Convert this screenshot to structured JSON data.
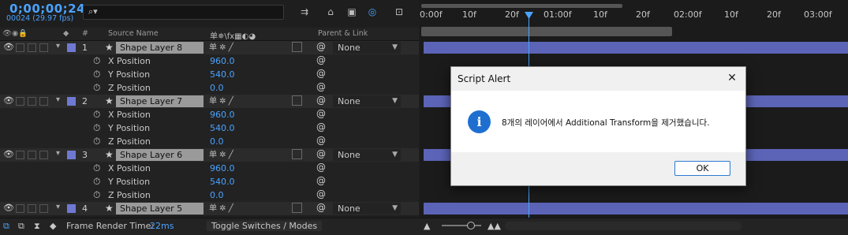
{
  "header": {
    "timecode": "0;00;00;24",
    "frame_info": "00024 (29.97 fps)",
    "search_placeholder": ""
  },
  "columns": {
    "num": "#",
    "source_name": "Source Name",
    "switches": "单✵\\fx▦◐◕",
    "parent_link": "Parent & Link"
  },
  "ruler": {
    "ticks": [
      "0:00f",
      "10f",
      "20f",
      "01:00f",
      "10f",
      "20f",
      "02:00f",
      "10f",
      "20f",
      "03:00f"
    ]
  },
  "layers": [
    {
      "num": "1",
      "name": "Shape Layer 8",
      "parent": "None",
      "props": [
        {
          "name": "X Position",
          "value": "960.0"
        },
        {
          "name": "Y Position",
          "value": "540.0"
        },
        {
          "name": "Z Position",
          "value": "0.0"
        }
      ]
    },
    {
      "num": "2",
      "name": "Shape Layer 7",
      "parent": "None",
      "props": [
        {
          "name": "X Position",
          "value": "960.0"
        },
        {
          "name": "Y Position",
          "value": "540.0"
        },
        {
          "name": "Z Position",
          "value": "0.0"
        }
      ]
    },
    {
      "num": "3",
      "name": "Shape Layer 6",
      "parent": "None",
      "props": [
        {
          "name": "X Position",
          "value": "960.0"
        },
        {
          "name": "Y Position",
          "value": "540.0"
        },
        {
          "name": "Z Position",
          "value": "0.0"
        }
      ]
    },
    {
      "num": "4",
      "name": "Shape Layer 5",
      "parent": "None",
      "props": []
    }
  ],
  "bottom": {
    "render_label": "Frame Render Time:",
    "render_value": "22ms",
    "toggle_label": "Toggle Switches / Modes"
  },
  "dialog": {
    "title": "Script Alert",
    "message": "8개의 레이어에서 Additional Transform을 제거했습니다.",
    "ok_label": "OK",
    "icon": "info-icon"
  },
  "colors": {
    "accent": "#4aa3ff",
    "layer_bar": "#5c64b8",
    "label": "#6f79d3"
  }
}
